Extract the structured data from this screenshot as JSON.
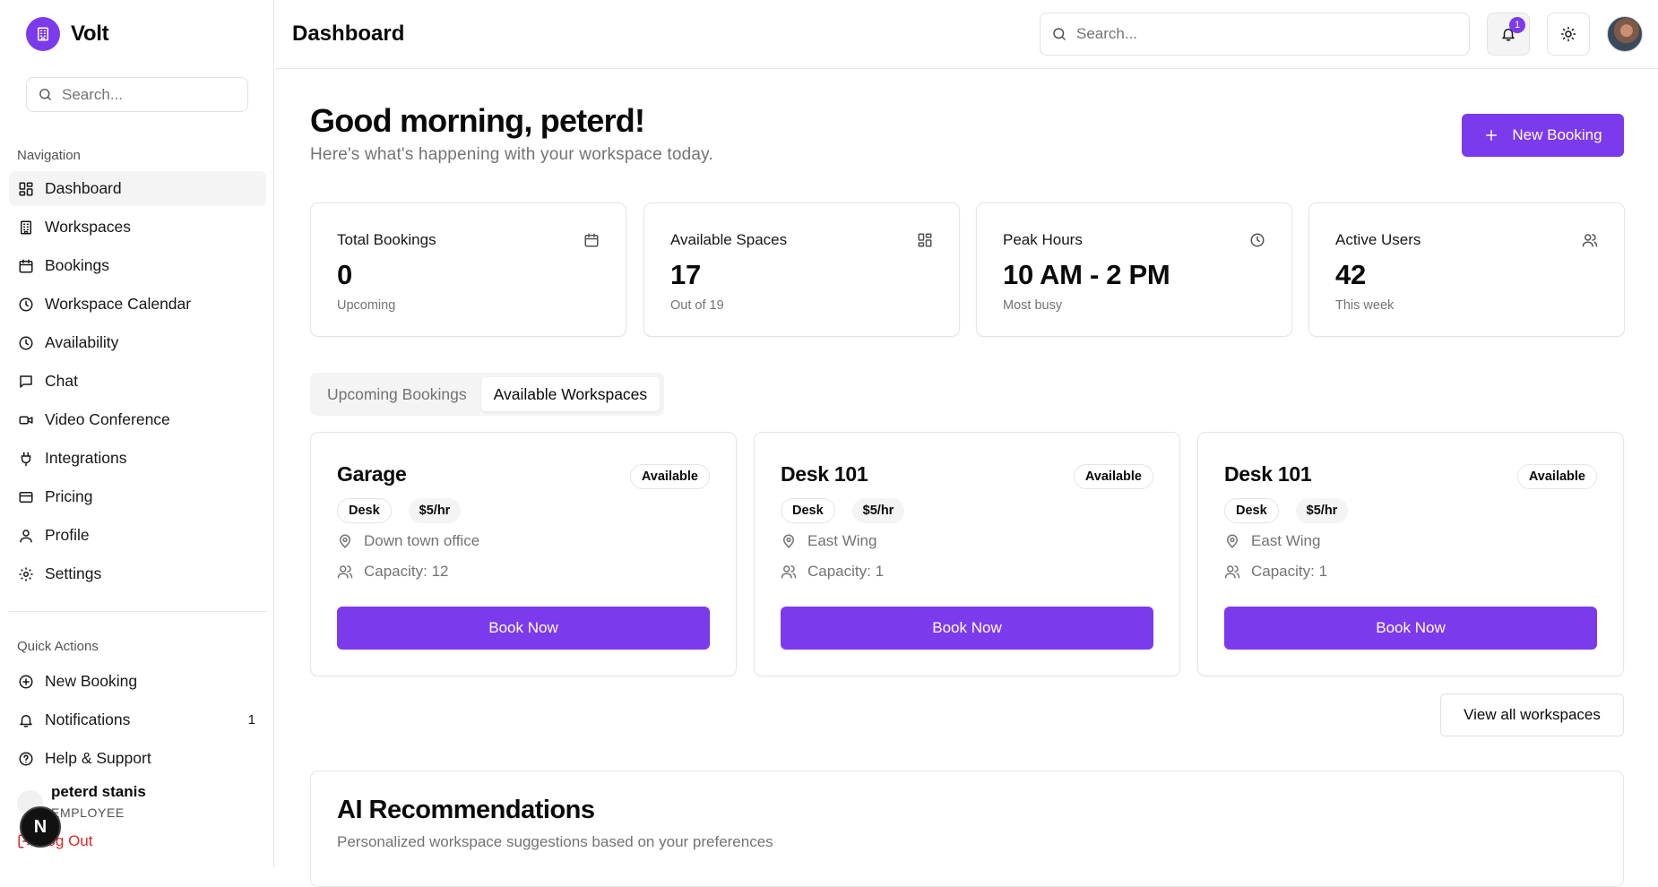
{
  "app": {
    "name": "Volt"
  },
  "sidebar": {
    "search_placeholder": "Search...",
    "nav_title": "Navigation",
    "nav_items": [
      {
        "label": "Dashboard",
        "icon": "layout-dashboard-icon",
        "active": true
      },
      {
        "label": "Workspaces",
        "icon": "building-icon"
      },
      {
        "label": "Bookings",
        "icon": "calendar-icon"
      },
      {
        "label": "Workspace Calendar",
        "icon": "clock-icon"
      },
      {
        "label": "Availability",
        "icon": "clock-icon"
      },
      {
        "label": "Chat",
        "icon": "message-square-icon"
      },
      {
        "label": "Video Conference",
        "icon": "video-icon"
      },
      {
        "label": "Integrations",
        "icon": "plug-icon"
      },
      {
        "label": "Pricing",
        "icon": "credit-card-icon"
      },
      {
        "label": "Profile",
        "icon": "user-icon"
      },
      {
        "label": "Settings",
        "icon": "settings-gear-icon"
      }
    ],
    "quick_title": "Quick Actions",
    "quick_items": [
      {
        "label": "New Booking",
        "icon": "plus-circle-icon"
      },
      {
        "label": "Notifications",
        "icon": "bell-icon",
        "count": "1"
      },
      {
        "label": "Help & Support",
        "icon": "help-circle-icon"
      }
    ],
    "user": {
      "name": "peterd stanis",
      "role": "EMPLOYEE"
    },
    "logout_label": "Log Out",
    "floating_initial": "N"
  },
  "header": {
    "title": "Dashboard",
    "search_placeholder": "Search...",
    "notification_count": "1"
  },
  "main": {
    "greeting": "Good morning, peterd!",
    "subgreeting": "Here's what's happening with your workspace today.",
    "new_booking_label": "New Booking",
    "stats": [
      {
        "label": "Total Bookings",
        "value": "0",
        "sub": "Upcoming",
        "icon": "calendar-icon"
      },
      {
        "label": "Available Spaces",
        "value": "17",
        "sub": "Out of 19",
        "icon": "layout-grid-icon"
      },
      {
        "label": "Peak Hours",
        "value": "10 AM - 2 PM",
        "sub": "Most busy",
        "icon": "clock-icon"
      },
      {
        "label": "Active Users",
        "value": "42",
        "sub": "This week",
        "icon": "users-icon"
      }
    ],
    "tabs": [
      {
        "label": "Upcoming Bookings",
        "active": false
      },
      {
        "label": "Available Workspaces",
        "active": true
      }
    ],
    "workspaces": [
      {
        "name": "Garage",
        "status": "Available",
        "type": "Desk",
        "price": "$5/hr",
        "location": "Down town office",
        "capacity": "Capacity: 12",
        "action": "Book Now"
      },
      {
        "name": "Desk 101",
        "status": "Available",
        "type": "Desk",
        "price": "$5/hr",
        "location": "East Wing",
        "capacity": "Capacity: 1",
        "action": "Book Now"
      },
      {
        "name": "Desk 101",
        "status": "Available",
        "type": "Desk",
        "price": "$5/hr",
        "location": "East Wing",
        "capacity": "Capacity: 1",
        "action": "Book Now"
      }
    ],
    "view_all_label": "View all workspaces",
    "ai": {
      "title": "AI Recommendations",
      "subtitle": "Personalized workspace suggestions based on your preferences"
    }
  },
  "colors": {
    "accent": "#7c3aed",
    "danger": "#dc2626",
    "muted": "#737373",
    "border": "#e5e5e5"
  }
}
